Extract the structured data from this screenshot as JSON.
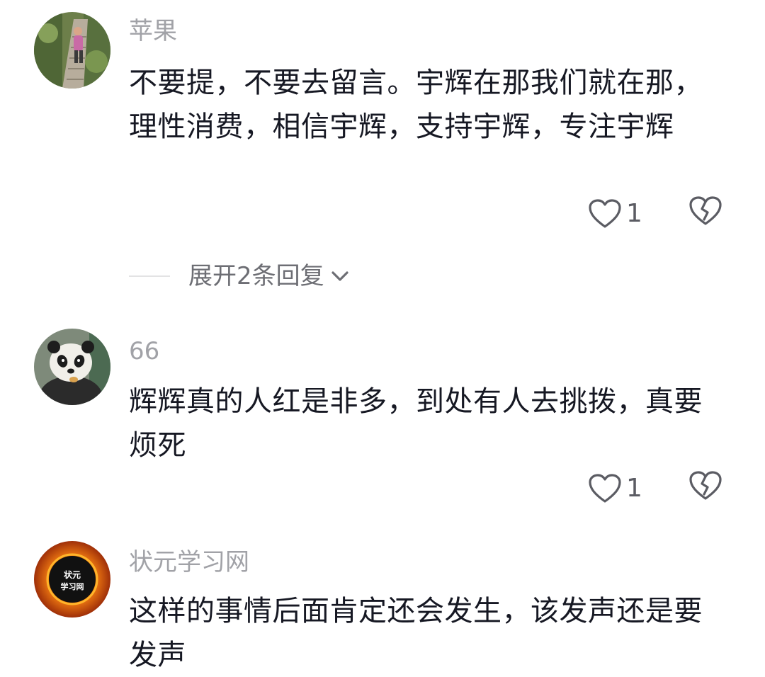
{
  "comments": [
    {
      "username": "苹果",
      "text": "不要提，不要去留言。宇辉在那我们就在那，理性消费，相信宇辉，支持宇辉，专注宇辉",
      "like_count": "1"
    },
    {
      "username": "66",
      "text": "辉辉真的人红是非多，到处有人去挑拨，真要烦死",
      "like_count": "1"
    },
    {
      "username": "状元学习网",
      "avatar_text": "状元学习网",
      "text": "这样的事情后面肯定还会发生，该发声还是要发声"
    }
  ],
  "replies": {
    "label": "展开2条回复"
  },
  "icons": {
    "like": "heart-outline-icon",
    "dislike": "broken-heart-icon",
    "expand": "chevron-down-icon"
  },
  "colors": {
    "text": "#161823",
    "username": "#a1a2a7",
    "icon": "#5b5c63"
  }
}
